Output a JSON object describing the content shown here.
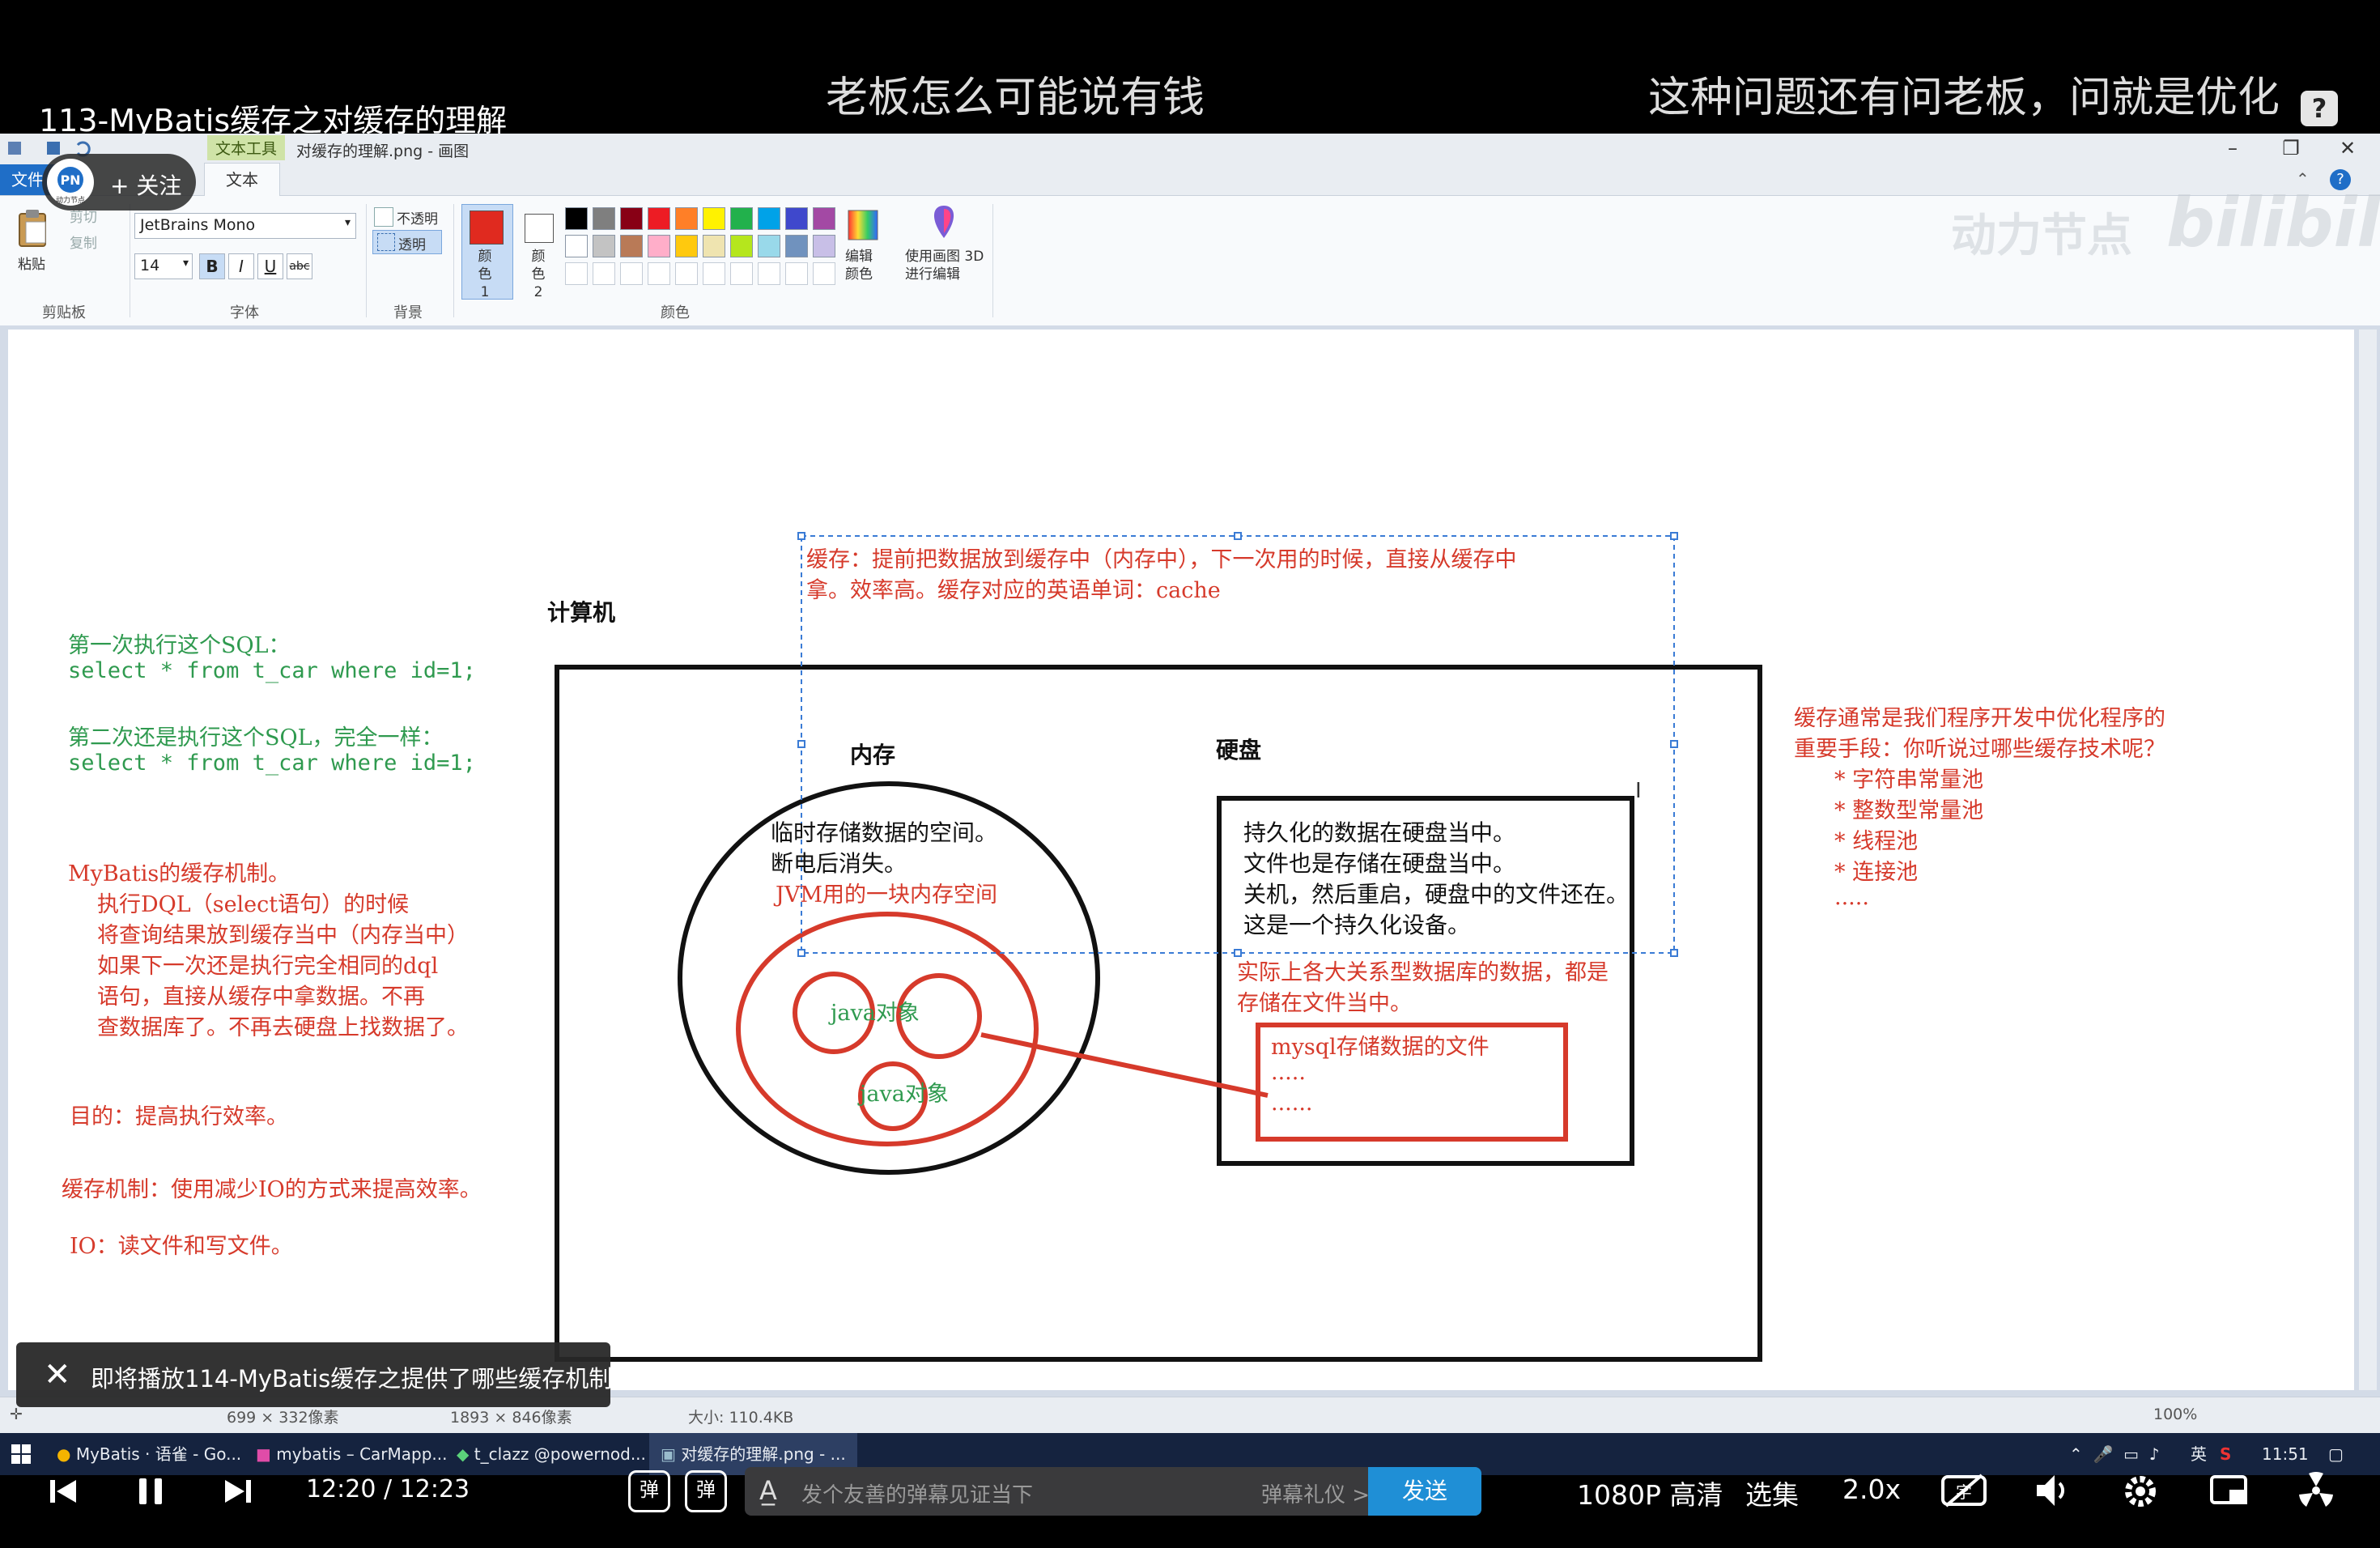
{
  "video": {
    "title": "113-MyBatis缓存之对缓存的理解",
    "danmu_1": "老板怎么可能说有钱",
    "danmu_2": "这种问题还有问老板，问就是优化"
  },
  "follow": {
    "label": "+ 关注",
    "logo_text": "动力节点"
  },
  "watermark": {
    "brand": "动力节点",
    "site": "bilibili"
  },
  "paint": {
    "window_title": "对缓存的理解.png - 画图",
    "tool_tab": "文本工具",
    "file_tab": "文件",
    "text_tab": "文本",
    "clipboard": {
      "paste": "粘贴",
      "cut": "剪切",
      "copy": "复制",
      "group": "剪贴板"
    },
    "font": {
      "family": "JetBrains Mono",
      "size": "14",
      "group": "字体",
      "bold": "B",
      "italic": "I",
      "underline": "U",
      "strike": "abc"
    },
    "background": {
      "opaque": "不透明",
      "transparent": "透明",
      "group": "背景"
    },
    "colors": {
      "color1": "颜色 1",
      "color2": "颜色 2",
      "edit": "编辑颜色",
      "paint3d": "使用画图 3D 进行编辑",
      "group": "颜色",
      "color1_value": "#e02a1f",
      "color2_value": "#ffffff",
      "palette_row1": [
        "#000000",
        "#7f7f7f",
        "#880015",
        "#ed1c24",
        "#ff7f27",
        "#fff200",
        "#22b14c",
        "#00a2e8",
        "#3f48cc",
        "#a349a4"
      ],
      "palette_row2": [
        "#ffffff",
        "#c3c3c3",
        "#b97a57",
        "#ffaec9",
        "#ffc90e",
        "#efe4b0",
        "#b5e61d",
        "#99d9ea",
        "#7092be",
        "#c8bfe7"
      ]
    },
    "status": {
      "selection": "699 × 332像素",
      "image": "1893 × 846像素",
      "filesize": "大小: 110.4KB",
      "zoom": "100%"
    }
  },
  "canvas": {
    "left_notes": [
      {
        "text": "第一次执行这个SQL：",
        "color": "green"
      },
      {
        "text": "select * from t_car where id=1;",
        "color": "green"
      },
      {
        "text": "第二次还是执行这个SQL，完全一样：",
        "color": "green"
      },
      {
        "text": "select * from t_car where id=1;",
        "color": "green"
      }
    ],
    "mechanism": [
      "MyBatis的缓存机制。",
      "执行DQL（select语句）的时候",
      "将查询结果放到缓存当中（内存当中）",
      "如果下一次还是执行完全相同的dql",
      "语句，直接从缓存中拿数据。不再",
      "查数据库了。不再去硬盘上找数据了。"
    ],
    "purpose": "目的：提高执行效率。",
    "cache_mech": "缓存机制：使用减少IO的方式来提高效率。",
    "io_def": "IO：读文件和写文件。",
    "cache_def_1": "缓存：提前把数据放到缓存中（内存中），下一次用的时候，直接从缓存中",
    "cache_def_2": "拿。效率高。缓存对应的英语单词：cache",
    "computer": "计算机",
    "memory": "内存",
    "disk": "硬盘",
    "mem_1": "临时存储数据的空间。",
    "mem_2": "断电后消失。",
    "mem_3": "JVM用的一块内存空间",
    "java_obj_1": "java对象",
    "java_obj_2": "java对象",
    "disk_1": "持久化的数据在硬盘当中。",
    "disk_2": "文件也是存储在硬盘当中。",
    "disk_3": "关机，然后重启，硬盘中的文件还在。",
    "disk_4": "这是一个持久化设备。",
    "db_1": "实际上各大关系型数据库的数据，都是",
    "db_2": "存储在文件当中。",
    "mysql_1": "mysql存储数据的文件",
    "mysql_2": ".....",
    "mysql_3": "......",
    "right_1": "缓存通常是我们程序开发中优化程序的",
    "right_2": "重要手段：你听说过哪些缓存技术呢？",
    "right_items": [
      "* 字符串常量池",
      "* 整数型常量池",
      "* 线程池",
      "* 连接池"
    ],
    "right_more": "....."
  },
  "next_toast": "即将播放114-MyBatis缓存之提供了哪些缓存机制",
  "taskbar": {
    "items": [
      "MyBatis · 语雀 - Go...",
      "mybatis – CarMapp...",
      "t_clazz @powernod...",
      "对缓存的理解.png - ..."
    ],
    "lang": "英",
    "clock": "11:51"
  },
  "player": {
    "time_current": "12:20",
    "time_sep": "/",
    "time_total": "12:23",
    "danmaku_placeholder": "发个友善的弹幕见证当下",
    "etiquette": "弹幕礼仪 >",
    "send": "发送",
    "quality": "1080P 高清",
    "episodes": "选集",
    "speed": "2.0x",
    "danmaku_btn_1": "弹",
    "danmaku_btn_2": "弹"
  }
}
